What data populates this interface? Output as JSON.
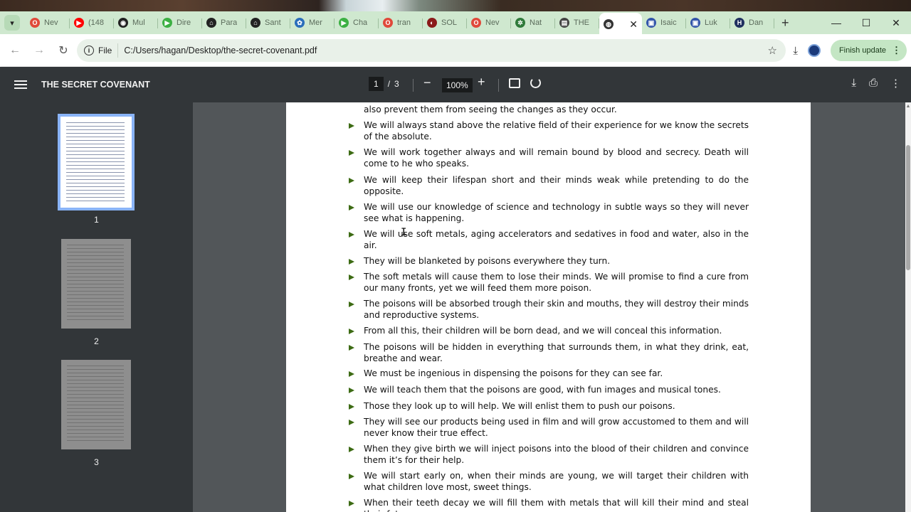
{
  "tabs": [
    {
      "label": "Nev",
      "color": "#e0493a",
      "glyph": "O"
    },
    {
      "label": "(148",
      "color": "#ff0000",
      "glyph": "▶"
    },
    {
      "label": "Mul",
      "color": "#222222",
      "glyph": "◉"
    },
    {
      "label": "Dire",
      "color": "#3cb043",
      "glyph": "▶"
    },
    {
      "label": "Para",
      "color": "#222222",
      "glyph": "⌂"
    },
    {
      "label": "Sant",
      "color": "#222222",
      "glyph": "⌂"
    },
    {
      "label": "Mer",
      "color": "#2a6ebb",
      "glyph": "✿"
    },
    {
      "label": "Cha",
      "color": "#3cb043",
      "glyph": "▶"
    },
    {
      "label": "tran",
      "color": "#e0493a",
      "glyph": "O"
    },
    {
      "label": "SOL",
      "color": "#8b1a1a",
      "glyph": "◐"
    },
    {
      "label": "Nev",
      "color": "#e0493a",
      "glyph": "O"
    },
    {
      "label": "Nat",
      "color": "#2f7a3a",
      "glyph": "✲"
    },
    {
      "label": "THE",
      "color": "#444444",
      "glyph": "▤"
    },
    {
      "label": "",
      "color": "#333333",
      "glyph": "◍",
      "active": true
    },
    {
      "label": "Isaic",
      "color": "#3355aa",
      "glyph": "▣"
    },
    {
      "label": "Luk",
      "color": "#3355aa",
      "glyph": "▣"
    },
    {
      "label": "Dan",
      "color": "#1f2f5f",
      "glyph": "H"
    }
  ],
  "address": {
    "scheme_label": "File",
    "url": "C:/Users/hagan/Desktop/the-secret-covenant.pdf",
    "update_label": "Finish update"
  },
  "pdf": {
    "title": "THE SECRET COVENANT",
    "current_page": "1",
    "separator": "/",
    "total_pages": "3",
    "zoom": "100%"
  },
  "thumbnails": [
    {
      "number": "1",
      "selected": true
    },
    {
      "number": "2",
      "selected": false
    },
    {
      "number": "3",
      "selected": false
    }
  ],
  "document": {
    "top_line": "also prevent them from seeing the changes as they occur.",
    "items": [
      "We will always stand above the relative field of their experience for we know the secrets of the absolute.",
      "We will work together always and will remain bound by blood and secrecy. Death will come to he who speaks.",
      "We will keep their lifespan short and their minds weak while pretending to do the opposite.",
      "We will use our knowledge of science and technology in subtle ways so they will never see what is happening.",
      "We will use soft metals, aging accelerators and sedatives in food and water, also in the air.",
      "They will be blanketed by poisons everywhere they turn.",
      "The soft metals will cause them to lose their minds. We will promise to find a cure from our many fronts, yet we will feed them more poison.",
      "The poisons will be absorbed trough their skin and mouths, they will destroy their minds and reproductive systems.",
      "From all this, their children will be born dead, and we will conceal this information.",
      "The poisons will be hidden in everything that surrounds them, in what they drink, eat, breathe and wear.",
      "We must be ingenious in dispensing the poisons for they can see far.",
      "We will teach them that the poisons are good, with fun images and musical tones.",
      "Those they look up to will help. We will enlist them to push our poisons.",
      "They will see our products being used in film and will grow accustomed to them and will never know their true effect.",
      "When they give birth we will inject poisons into the blood of their children and convince them it’s for their help.",
      "We will start early on, when their minds are young, we will target their children with what children love most, sweet things.",
      "When their teeth decay we will fill them with metals that will kill their mind and steal their future."
    ]
  }
}
